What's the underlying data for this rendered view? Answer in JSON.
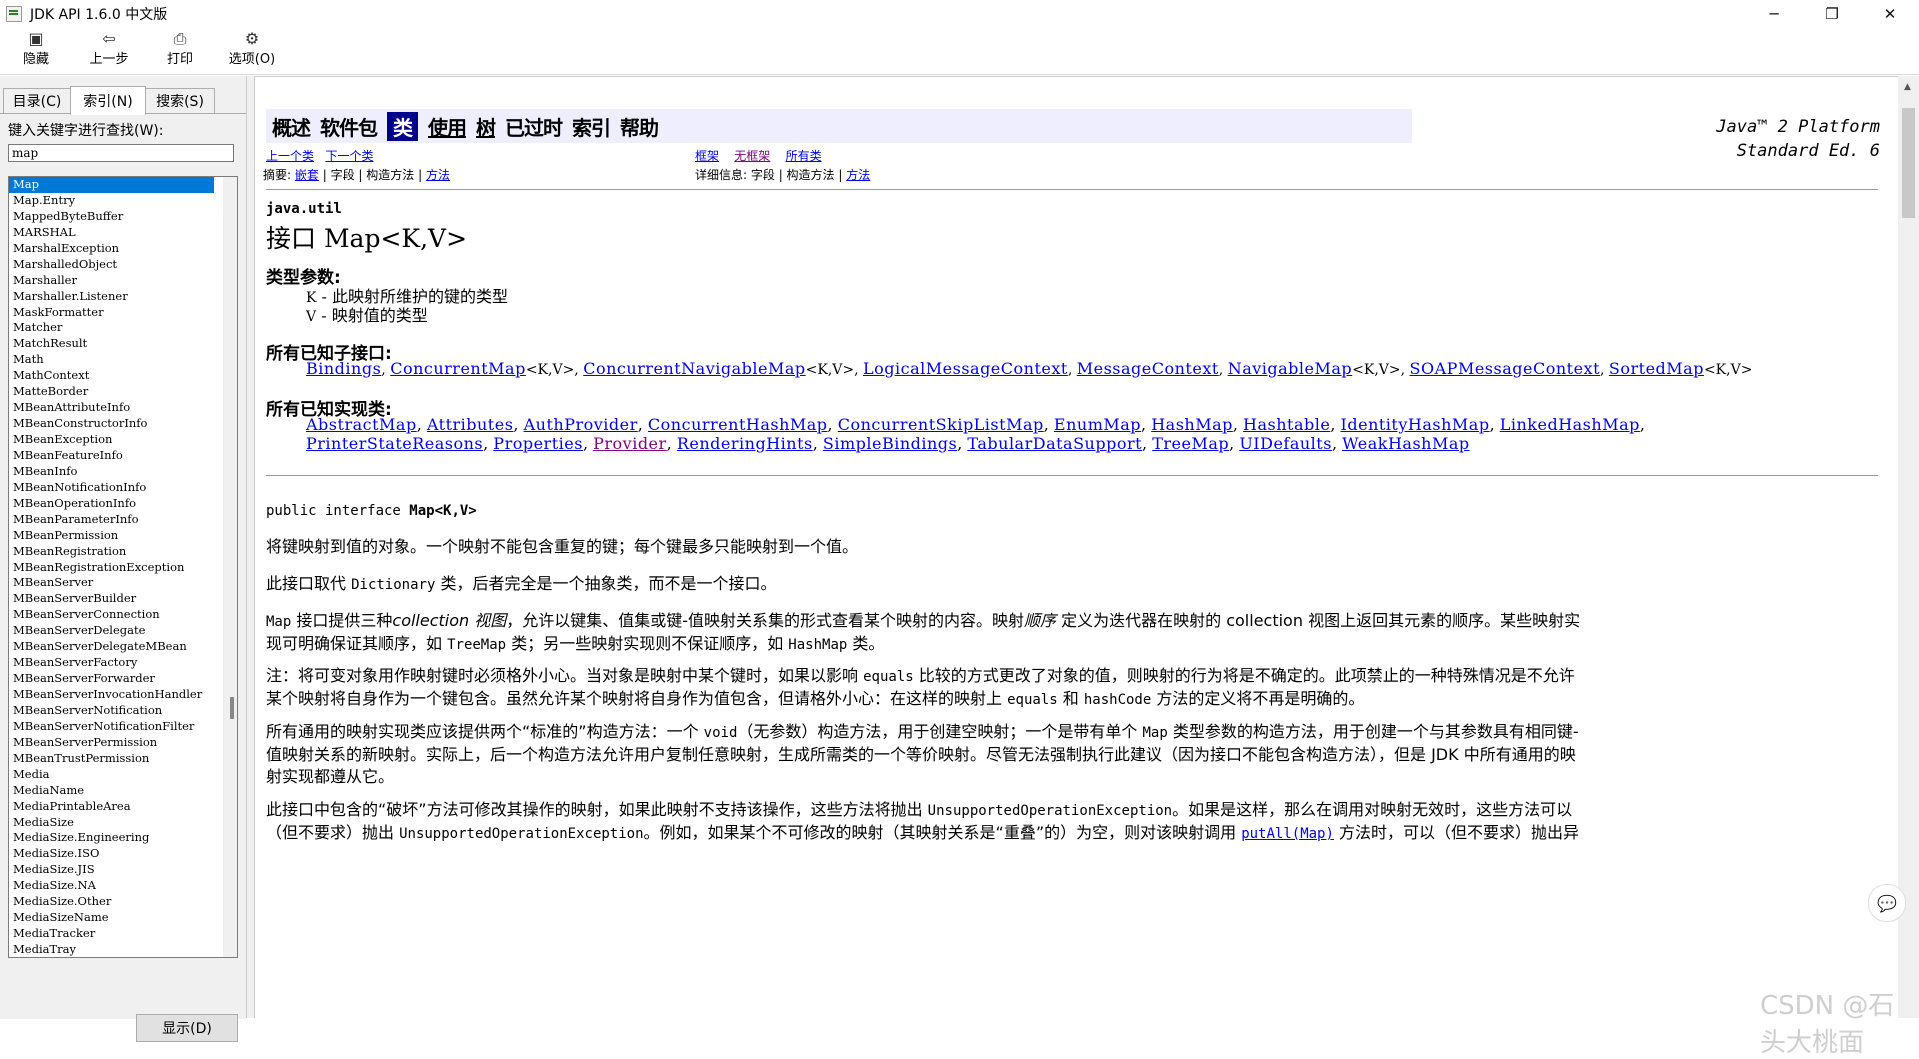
{
  "window": {
    "title": "JDK API 1.6.0 中文版",
    "minimize": "─",
    "restore": "❐",
    "close": "✕"
  },
  "toolbar": [
    {
      "icon": "hide-icon",
      "glyph": "▣",
      "label": "隐藏"
    },
    {
      "icon": "back-icon",
      "glyph": "⇦",
      "label": "上一步"
    },
    {
      "icon": "print-icon",
      "glyph": "⎙",
      "label": "打印"
    },
    {
      "icon": "options-icon",
      "glyph": "⚙",
      "label": "选项(O)"
    }
  ],
  "tabs": [
    {
      "label": "目录(C)",
      "active": false
    },
    {
      "label": "索引(N)",
      "active": true
    },
    {
      "label": "搜索(S)",
      "active": false
    }
  ],
  "index": {
    "keyword_label": "键入关键字进行查找(W):",
    "keyword_value": "map",
    "items": [
      "Map",
      "Map.Entry",
      "MappedByteBuffer",
      "MARSHAL",
      "MarshalException",
      "MarshalledObject",
      "Marshaller",
      "Marshaller.Listener",
      "MaskFormatter",
      "Matcher",
      "MatchResult",
      "Math",
      "MathContext",
      "MatteBorder",
      "MBeanAttributeInfo",
      "MBeanConstructorInfo",
      "MBeanException",
      "MBeanFeatureInfo",
      "MBeanInfo",
      "MBeanNotificationInfo",
      "MBeanOperationInfo",
      "MBeanParameterInfo",
      "MBeanPermission",
      "MBeanRegistration",
      "MBeanRegistrationException",
      "MBeanServer",
      "MBeanServerBuilder",
      "MBeanServerConnection",
      "MBeanServerDelegate",
      "MBeanServerDelegateMBean",
      "MBeanServerFactory",
      "MBeanServerForwarder",
      "MBeanServerInvocationHandler",
      "MBeanServerNotification",
      "MBeanServerNotificationFilter",
      "MBeanServerPermission",
      "MBeanTrustPermission",
      "Media",
      "MediaName",
      "MediaPrintableArea",
      "MediaSize",
      "MediaSize.Engineering",
      "MediaSize.ISO",
      "MediaSize.JIS",
      "MediaSize.NA",
      "MediaSize.Other",
      "MediaSizeName",
      "MediaTracker",
      "MediaTray"
    ],
    "selected": "Map",
    "show_button": "显示(D)"
  },
  "nav": {
    "items": [
      "概述",
      "软件包",
      "类",
      "使用",
      "树",
      "已过时",
      "索引",
      "帮助"
    ],
    "active": "类",
    "brand_line1": "Java™ 2 Platform",
    "brand_line2": "Standard Ed. 6",
    "prev_class": "上一个类",
    "next_class": "下一个类",
    "frames": "框架",
    "no_frames": "无框架",
    "all_classes": "所有类",
    "summary_label": "摘要:",
    "summary_nested": "嵌套",
    "summary_sep1": "| 字段 | 构造方法 |",
    "summary_method": "方法",
    "detail_label": "详细信息:",
    "detail_sep": "字段 | 构造方法 |",
    "detail_method": "方法"
  },
  "doc": {
    "package": "java.util",
    "title": "接口 Map<K,V>",
    "type_params_label": "类型参数:",
    "type_params": [
      {
        "name": "K",
        "desc": " - 此映射所维护的键的类型"
      },
      {
        "name": "V",
        "desc": " - 映射值的类型"
      }
    ],
    "subinterfaces_label": "所有已知子接口:",
    "subinterfaces": [
      {
        "name": "Bindings",
        "suffix": ", "
      },
      {
        "name": "ConcurrentMap",
        "suffix": "<K,V>, "
      },
      {
        "name": "ConcurrentNavigableMap",
        "suffix": "<K,V>, "
      },
      {
        "name": "LogicalMessageContext",
        "suffix": ", "
      },
      {
        "name": "MessageContext",
        "suffix": ", "
      },
      {
        "name": "NavigableMap",
        "suffix": "<K,V>, "
      },
      {
        "name": "SOAPMessageContext",
        "suffix": ", "
      },
      {
        "name": "SortedMap",
        "suffix": "<K,V>"
      }
    ],
    "implementing_label": "所有已知实现类:",
    "implementing_line1": [
      "AbstractMap",
      "Attributes",
      "AuthProvider",
      "ConcurrentHashMap",
      "ConcurrentSkipListMap",
      "EnumMap",
      "HashMap",
      "Hashtable",
      "IdentityHashMap",
      "LinkedHashMap"
    ],
    "implementing_line2": [
      "PrinterStateReasons",
      "Properties",
      "Provider",
      "RenderingHints",
      "SimpleBindings",
      "TabularDataSupport",
      "TreeMap",
      "UIDefaults",
      "WeakHashMap"
    ],
    "visited_link": "Provider",
    "signature_prefix": "public interface ",
    "signature_name": "Map<K,V>",
    "p1": "将键映射到值的对象。一个映射不能包含重复的键；每个键最多只能映射到一个值。",
    "p2a": "此接口取代 ",
    "p2code": "Dictionary",
    "p2b": " 类，后者完全是一个抽象类，而不是一个接口。",
    "p3a": "Map",
    "p3b": " 接口提供三种",
    "p3italic": "collection 视图",
    "p3c": "，允许以键集、值集或键-值映射关系集的形式查看某个映射的内容。映射",
    "p3italic2": "顺序",
    "p3d": " 定义为迭代器在映射的 collection 视图上返回其元素的顺序。某些映射实现可明确保证其顺序，如 ",
    "p3code1": "TreeMap",
    "p3e": " 类；另一些映射实现则不保证顺序，如 ",
    "p3code2": "HashMap",
    "p3f": " 类。",
    "p4a": "注：将可变对象用作映射键时必须格外小心。当对象是映射中某个键时，如果以影响 ",
    "p4code1": "equals",
    "p4b": " 比较的方式更改了对象的值，则映射的行为将是不确定的。此项禁止的一种特殊情况是不允许某个映射将自身作为一个键包含。虽然允许某个映射将自身作为值包含，但请格外小心：在这样的映射上 ",
    "p4code2": "equals",
    "p4c": " 和 ",
    "p4code3": "hashCode",
    "p4d": " 方法的定义将不再是明确的。",
    "p5a": "所有通用的映射实现类应该提供两个“标准的”构造方法：一个 ",
    "p5code1": "void",
    "p5b": "（无参数）构造方法，用于创建空映射；一个是带有单个 ",
    "p5code2": "Map",
    "p5c": " 类型参数的构造方法，用于创建一个与其参数具有相同键-值映射关系的新映射。实际上，后一个构造方法允许用户复制任意映射，生成所需类的一个等价映射。尽管无法强制执行此建议（因为接口不能包含构造方法），但是 JDK 中所有通用的映射实现都遵从它。",
    "p6a": "此接口中包含的“破坏”方法可修改其操作的映射，如果此映射不支持该操作，这些方法将抛出 ",
    "p6code1": "UnsupportedOperationException",
    "p6b": "。如果是这样，那么在调用对映射无效时，这些方法可以（但不要求）抛出 ",
    "p6code2": "UnsupportedOperationException",
    "p6c": "。例如，如果某个不可修改的映射（其映射关系是“重叠”的）为空，则对该映射调用 ",
    "p6link": "putAll(Map)",
    "p6d": " 方法时，可以（但不要求）抛出异"
  },
  "watermark": "CSDN @石头大桃面"
}
